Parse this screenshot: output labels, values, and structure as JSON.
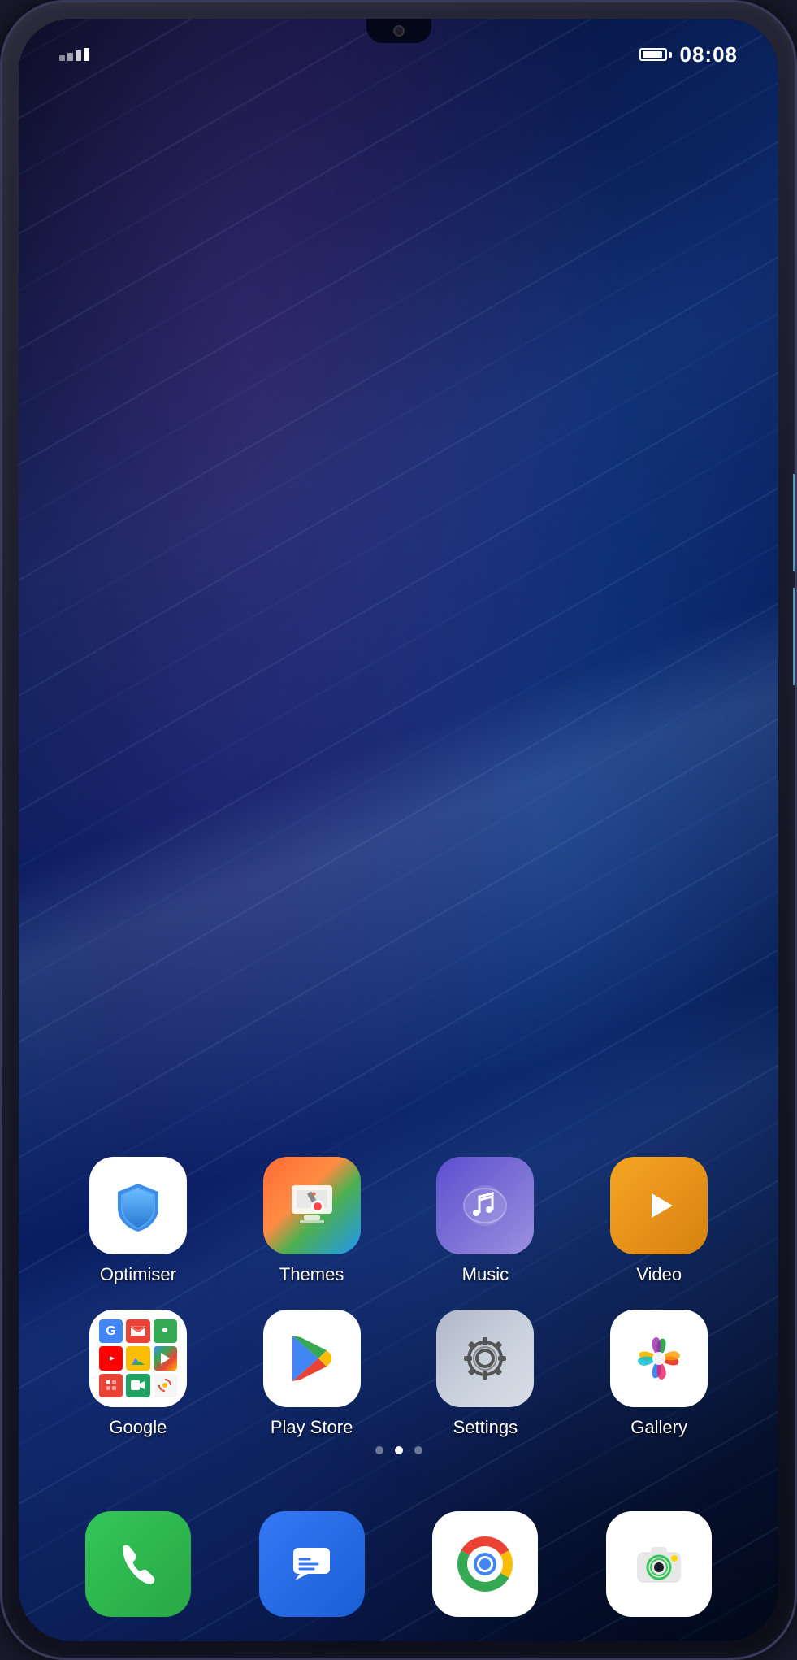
{
  "phone": {
    "status_bar": {
      "time": "08:08",
      "signal_bars": [
        1,
        2,
        3,
        4
      ],
      "battery_level": "80%"
    },
    "apps": {
      "row1": [
        {
          "id": "optimiser",
          "label": "Optimiser",
          "icon_type": "optimiser"
        },
        {
          "id": "themes",
          "label": "Themes",
          "icon_type": "themes"
        },
        {
          "id": "music",
          "label": "Music",
          "icon_type": "music"
        },
        {
          "id": "video",
          "label": "Video",
          "icon_type": "video"
        }
      ],
      "row2": [
        {
          "id": "google",
          "label": "Google",
          "icon_type": "google"
        },
        {
          "id": "playstore",
          "label": "Play Store",
          "icon_type": "playstore"
        },
        {
          "id": "settings",
          "label": "Settings",
          "icon_type": "settings"
        },
        {
          "id": "gallery",
          "label": "Gallery",
          "icon_type": "gallery"
        }
      ]
    },
    "dock": [
      {
        "id": "phone",
        "label": "Phone",
        "icon_type": "phone"
      },
      {
        "id": "messages",
        "label": "Messages",
        "icon_type": "messages"
      },
      {
        "id": "chrome",
        "label": "Chrome",
        "icon_type": "chrome"
      },
      {
        "id": "camera",
        "label": "Camera",
        "icon_type": "camera"
      }
    ],
    "page_dots": [
      0,
      1,
      2
    ],
    "active_dot": 1
  }
}
